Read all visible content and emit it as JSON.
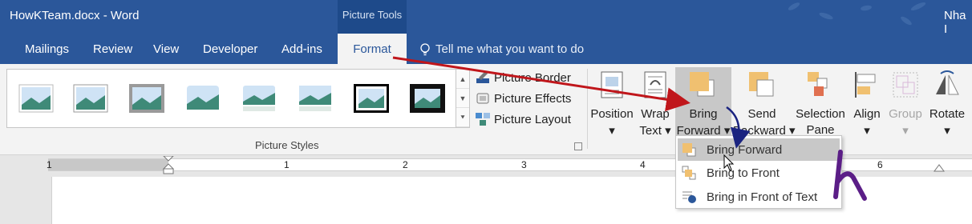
{
  "window": {
    "title": "HowKTeam.docx - Word",
    "contextual_tab": "Picture Tools",
    "user": "Nha I"
  },
  "tabs": [
    "Mailings",
    "Review",
    "View",
    "Developer",
    "Add-ins"
  ],
  "active_tab": "Format",
  "tell_me": "Tell me what you want to do",
  "picture_styles": {
    "group_label": "Picture Styles",
    "thumbnails": [
      "simple-frame-white",
      "soft-edge",
      "drop-shadow-rectangle",
      "rounded-diagonal",
      "reflected-rounded",
      "reflected-bevel",
      "thick-matte-black",
      "metal-frame-black"
    ]
  },
  "picture_commands": [
    {
      "label": "Picture Border",
      "icon": "pen-border-icon"
    },
    {
      "label": "Picture Effects",
      "icon": "effects-icon"
    },
    {
      "label": "Picture Layout",
      "icon": "smartart-layout-icon"
    }
  ],
  "arrange": [
    {
      "name": "position",
      "line1": "Position",
      "line2": "",
      "disabled": false
    },
    {
      "name": "wrap-text",
      "line1": "Wrap",
      "line2": "Text",
      "disabled": false
    },
    {
      "name": "bring-forward",
      "line1": "Bring",
      "line2": "Forward",
      "disabled": false
    },
    {
      "name": "send-backward",
      "line1": "Send",
      "line2": "Backward",
      "disabled": false
    },
    {
      "name": "selection-pane",
      "line1": "Selection",
      "line2": "Pane",
      "disabled": false
    },
    {
      "name": "align",
      "line1": "Align",
      "line2": "",
      "disabled": true
    },
    {
      "name": "group",
      "line1": "Group",
      "line2": "",
      "disabled": true
    },
    {
      "name": "rotate",
      "line1": "Rotate",
      "line2": "",
      "disabled": false
    }
  ],
  "ruler_numbers": [
    "1",
    "1",
    "2",
    "3",
    "4",
    "6"
  ],
  "dropdown": {
    "items": [
      {
        "label": "Bring Forward",
        "active": true
      },
      {
        "label": "Bring to Front",
        "active": false
      },
      {
        "label": "Bring in Front of Text",
        "active": false
      }
    ]
  },
  "colors": {
    "ribbon_blue": "#2b579a",
    "annotation_red": "#c0161b",
    "annotation_navy": "#1a2380",
    "logo_purple": "#5b1e87"
  }
}
